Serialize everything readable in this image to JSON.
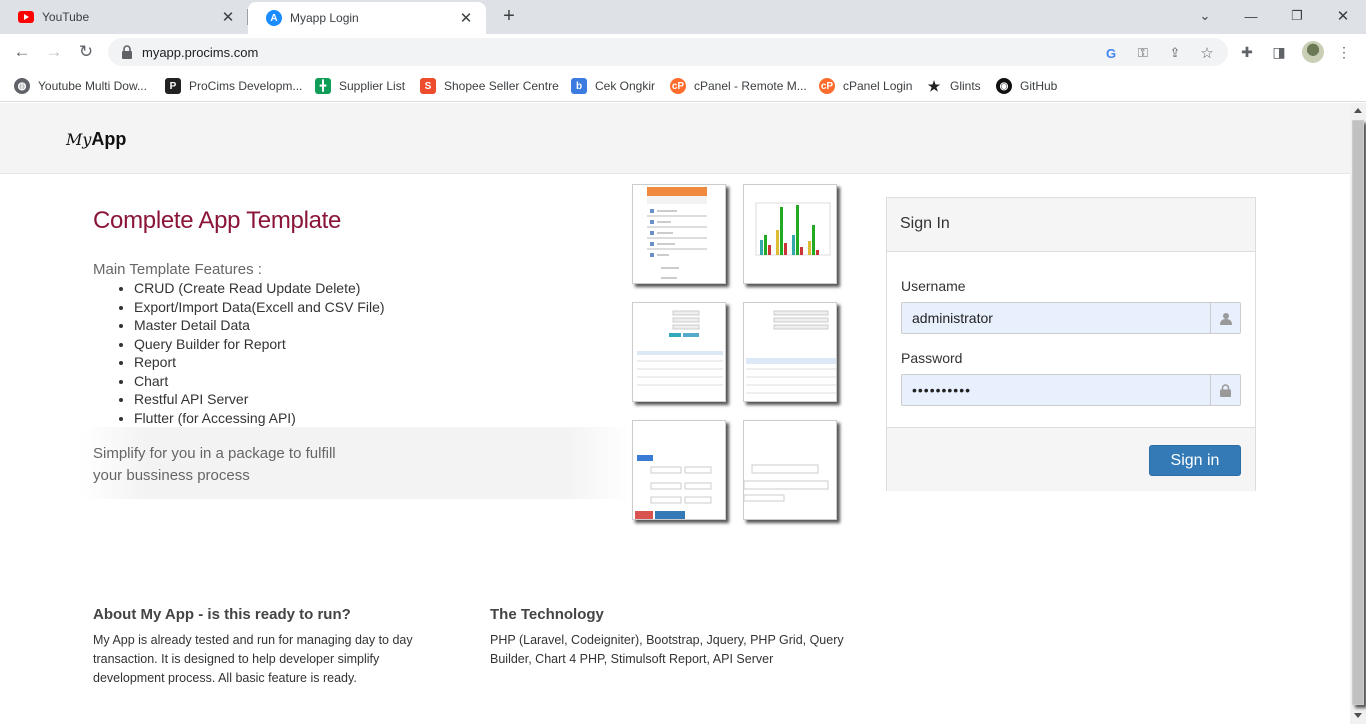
{
  "browser": {
    "tabs": [
      {
        "title": "YouTube",
        "icon": "youtube-icon",
        "active": false
      },
      {
        "title": "Myapp Login",
        "icon": "app-store-icon",
        "active": true
      }
    ],
    "url": "myapp.procims.com",
    "bookmarks": [
      {
        "label": "Youtube Multi Dow...",
        "icon": "globe-icon"
      },
      {
        "label": "ProCims Developm...",
        "icon": "procims-icon"
      },
      {
        "label": "Supplier List",
        "icon": "sheets-icon"
      },
      {
        "label": "Shopee Seller Centre",
        "icon": "shopee-icon"
      },
      {
        "label": "Cek Ongkir",
        "icon": "b-icon"
      },
      {
        "label": "cPanel - Remote M...",
        "icon": "cpanel-icon"
      },
      {
        "label": "cPanel Login",
        "icon": "cpanel-icon"
      },
      {
        "label": "Glints",
        "icon": "glints-icon"
      },
      {
        "label": "GitHub",
        "icon": "github-icon"
      }
    ]
  },
  "navbar": {
    "brand_my": "My",
    "brand_app": "App"
  },
  "hero": {
    "title": "Complete App Template",
    "features_heading": "Main Template Features :",
    "features": [
      "CRUD (Create Read Update Delete)",
      "Export/Import Data(Excell and CSV File)",
      "Master Detail Data",
      "Query Builder for Report",
      "Report",
      "Chart",
      "Restful API Server",
      "Flutter (for Accessing API)"
    ],
    "tagline_line1": "Simplify for you in a package to fulfill",
    "tagline_line2": "your bussiness process"
  },
  "login": {
    "heading": "Sign In",
    "username_label": "Username",
    "username_value": "administrator",
    "password_label": "Password",
    "password_value": "••••••••••",
    "submit_label": "Sign in"
  },
  "about": {
    "title": "About My App - is this ready to run?",
    "text_line1": "My App is already tested and run for managing day to day",
    "text_line2": "transaction. It is designed to help developer simplify",
    "text_line3": "development process. All basic feature is ready."
  },
  "technology": {
    "title": "The Technology",
    "text_line1": "PHP (Laravel, Codeigniter), Bootstrap, Jquery, PHP Grid, Query",
    "text_line2": "Builder, Chart 4 PHP, Stimulsoft Report, API Server"
  },
  "colors": {
    "accent": "#8b1538",
    "button": "#337ab7",
    "autofill": "#e8f0fe"
  }
}
